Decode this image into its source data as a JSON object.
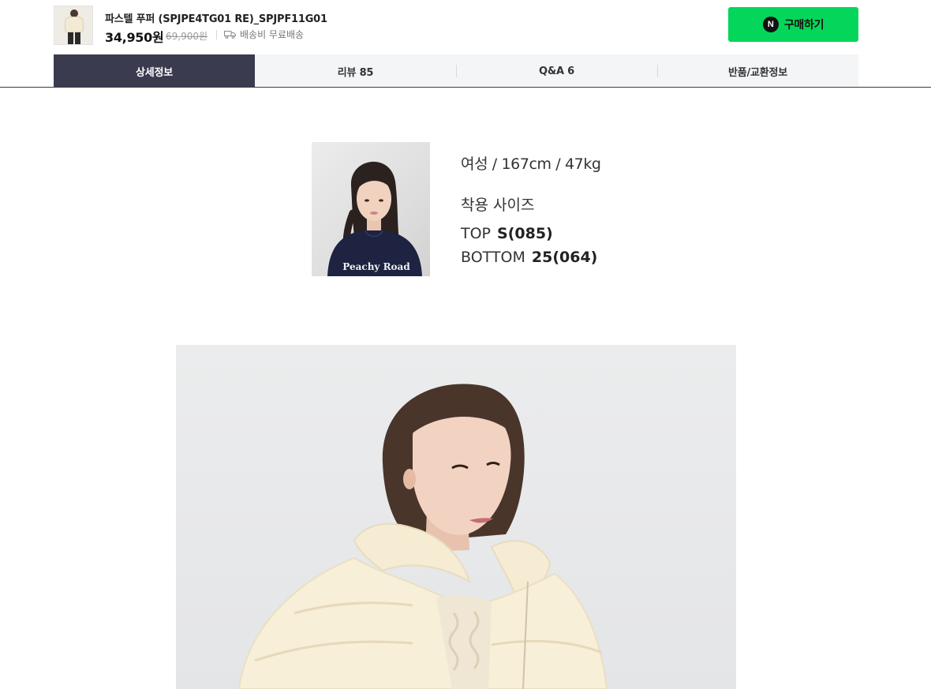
{
  "product": {
    "title": "파스텔 푸퍼 (SPJPE4TG01 RE)_SPJPF11G01",
    "price": "34,950원",
    "original_price": "69,900원",
    "shipping": "배송비 무료배송",
    "thumbnail_icon": "product-thumbnail",
    "shipping_icon": "truck-icon"
  },
  "buy_button": {
    "label": "구매하기",
    "icon_text": "N",
    "color": "#03d65a"
  },
  "tabs": [
    {
      "label": "상세정보",
      "active": true
    },
    {
      "label": "리뷰 85",
      "active": false
    },
    {
      "label": "Q&A 6",
      "active": false
    },
    {
      "label": "반품/교환정보",
      "active": false
    }
  ],
  "model": {
    "body": "여성 / 167cm / 47kg",
    "size_label": "착용 사이즈",
    "top_key": "TOP",
    "top_value": "S(085)",
    "bottom_key": "BOTTOM",
    "bottom_value": "25(064)",
    "shirt_text": "Peachy Road"
  },
  "colors": {
    "active_tab": "#3b3b4f",
    "tab_bg": "#f4f5f7",
    "buy_green": "#03d65a"
  }
}
